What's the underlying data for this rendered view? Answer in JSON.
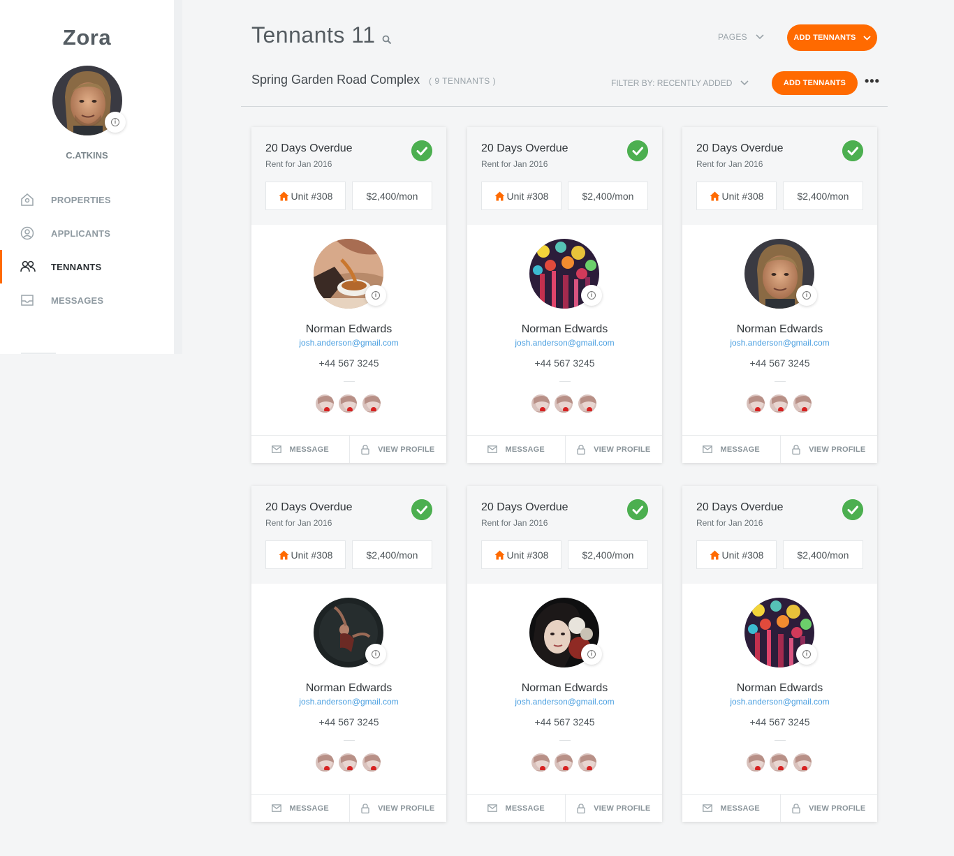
{
  "app": {
    "brand": "Zora",
    "username": "C.ATKINS",
    "accent": "#ff6a00",
    "link_color": "#4a9fe0",
    "status_color": "#4caf50"
  },
  "sidebar": {
    "items": [
      {
        "label": "PROPERTIES",
        "icon": "home-icon",
        "active": false
      },
      {
        "label": "APPLICANTS",
        "icon": "user-circle-icon",
        "active": false
      },
      {
        "label": "TENNANTS",
        "icon": "users-icon",
        "active": true
      },
      {
        "label": "MESSAGES",
        "icon": "inbox-icon",
        "active": false
      }
    ]
  },
  "header": {
    "title": "Tennants 11",
    "pages_label": "PAGES",
    "add_button": "ADD TENNANTS",
    "property": "Spring Garden Road Complex",
    "property_count": "( 9 TENNANTS )",
    "filter_label": "FILTER BY: RECENTLY ADDED",
    "add_button_2": "ADD TENNANTS",
    "more": "•••"
  },
  "cards": [
    {
      "status": "20 Days Overdue",
      "rent": "Rent for Jan 2016",
      "unit": "Unit #308",
      "price": "$2,400/mon",
      "name": "Norman Edwards",
      "email": "josh.anderson@gmail.com",
      "phone": "+44 567 3245",
      "avatar": "coffee",
      "message": "MESSAGE",
      "profile": "VIEW PROFILE"
    },
    {
      "status": "20 Days Overdue",
      "rent": "Rent for Jan 2016",
      "unit": "Unit #308",
      "price": "$2,400/mon",
      "name": "Norman Edwards",
      "email": "josh.anderson@gmail.com",
      "phone": "+44 567 3245",
      "avatar": "paint",
      "message": "MESSAGE",
      "profile": "VIEW PROFILE"
    },
    {
      "status": "20 Days Overdue",
      "rent": "Rent for Jan 2016",
      "unit": "Unit #308",
      "price": "$2,400/mon",
      "name": "Norman Edwards",
      "email": "josh.anderson@gmail.com",
      "phone": "+44 567 3245",
      "avatar": "man",
      "message": "MESSAGE",
      "profile": "VIEW PROFILE"
    },
    {
      "status": "20 Days Overdue",
      "rent": "Rent for Jan 2016",
      "unit": "Unit #308",
      "price": "$2,400/mon",
      "name": "Norman Edwards",
      "email": "josh.anderson@gmail.com",
      "phone": "+44 567 3245",
      "avatar": "dancer",
      "message": "MESSAGE",
      "profile": "VIEW PROFILE"
    },
    {
      "status": "20 Days Overdue",
      "rent": "Rent for Jan 2016",
      "unit": "Unit #308",
      "price": "$2,400/mon",
      "name": "Norman Edwards",
      "email": "josh.anderson@gmail.com",
      "phone": "+44 567 3245",
      "avatar": "woman",
      "message": "MESSAGE",
      "profile": "VIEW PROFILE"
    },
    {
      "status": "20 Days Overdue",
      "rent": "Rent for Jan 2016",
      "unit": "Unit #308",
      "price": "$2,400/mon",
      "name": "Norman Edwards",
      "email": "josh.anderson@gmail.com",
      "phone": "+44 567 3245",
      "avatar": "paint",
      "message": "MESSAGE",
      "profile": "VIEW PROFILE"
    }
  ]
}
